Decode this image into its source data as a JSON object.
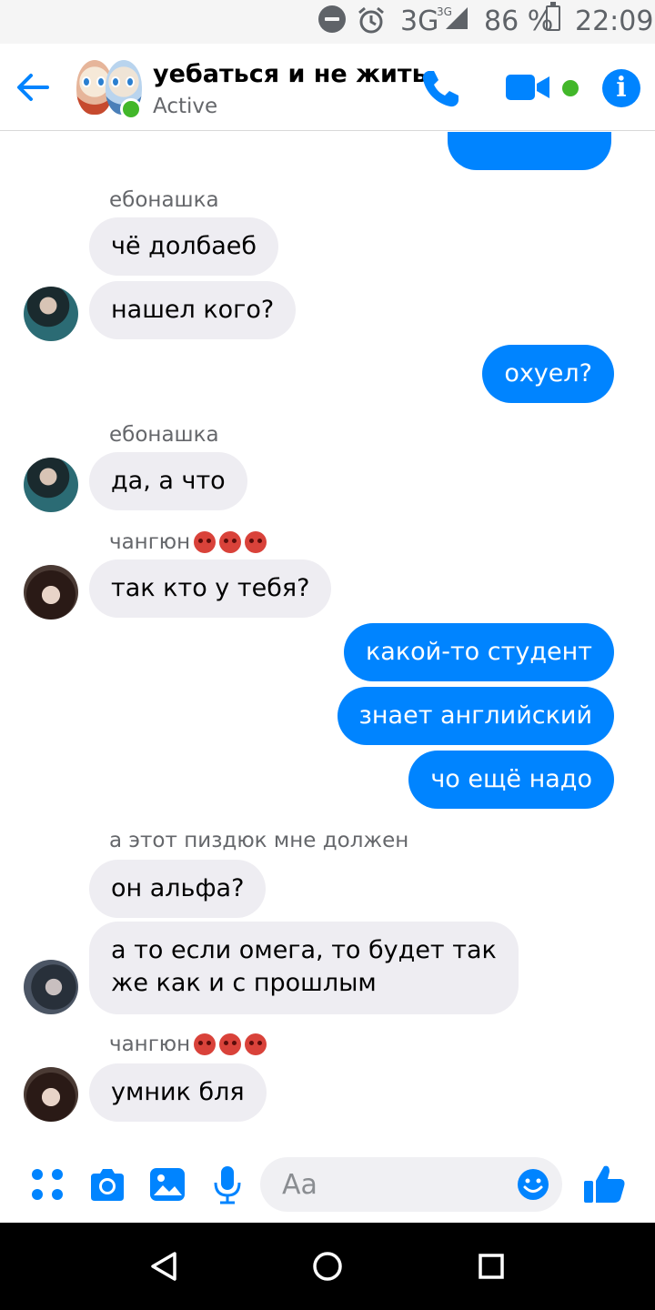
{
  "status_bar": {
    "network": "3G",
    "network_sup": "3G",
    "battery": "86 %",
    "time": "22:09"
  },
  "header": {
    "title": "уебаться и не жить",
    "status": "Active",
    "back_icon": "back-arrow-icon",
    "call_icon": "phone-icon",
    "video_icon": "video-camera-icon",
    "info_icon": "info-icon",
    "info_glyph": "i"
  },
  "messages": [
    {
      "side": "in",
      "sender": "ебонашка",
      "text": "чё долбаеб"
    },
    {
      "side": "in",
      "text": "нашел кого?"
    },
    {
      "side": "out",
      "text": "охуел?"
    },
    {
      "side": "in",
      "sender": "ебонашка",
      "text": "да, а что"
    },
    {
      "side": "in",
      "sender": "чангюн",
      "text": "так кто у тебя?"
    },
    {
      "side": "out",
      "text": "какой-то студент"
    },
    {
      "side": "out",
      "text": "знает английский"
    },
    {
      "side": "out",
      "text": "чо ещё надо"
    },
    {
      "side": "in",
      "sender": "а этот пиздюк мне должен",
      "text": "он альфа?"
    },
    {
      "side": "in",
      "text": "а то если омега, то будет так"
    },
    {
      "side": "in",
      "text": "же как и с прошлым"
    },
    {
      "side": "in",
      "sender": "чангюн",
      "text": "умник бля"
    }
  ],
  "composer": {
    "placeholder": "Aa",
    "icons": [
      "menu-dots-icon",
      "camera-icon",
      "gallery-icon",
      "microphone-icon",
      "emoji-icon",
      "thumbs-up-icon"
    ]
  },
  "colors": {
    "accent": "#0084ff",
    "incoming_bubble": "#eeedf2",
    "online": "#42b72a"
  }
}
